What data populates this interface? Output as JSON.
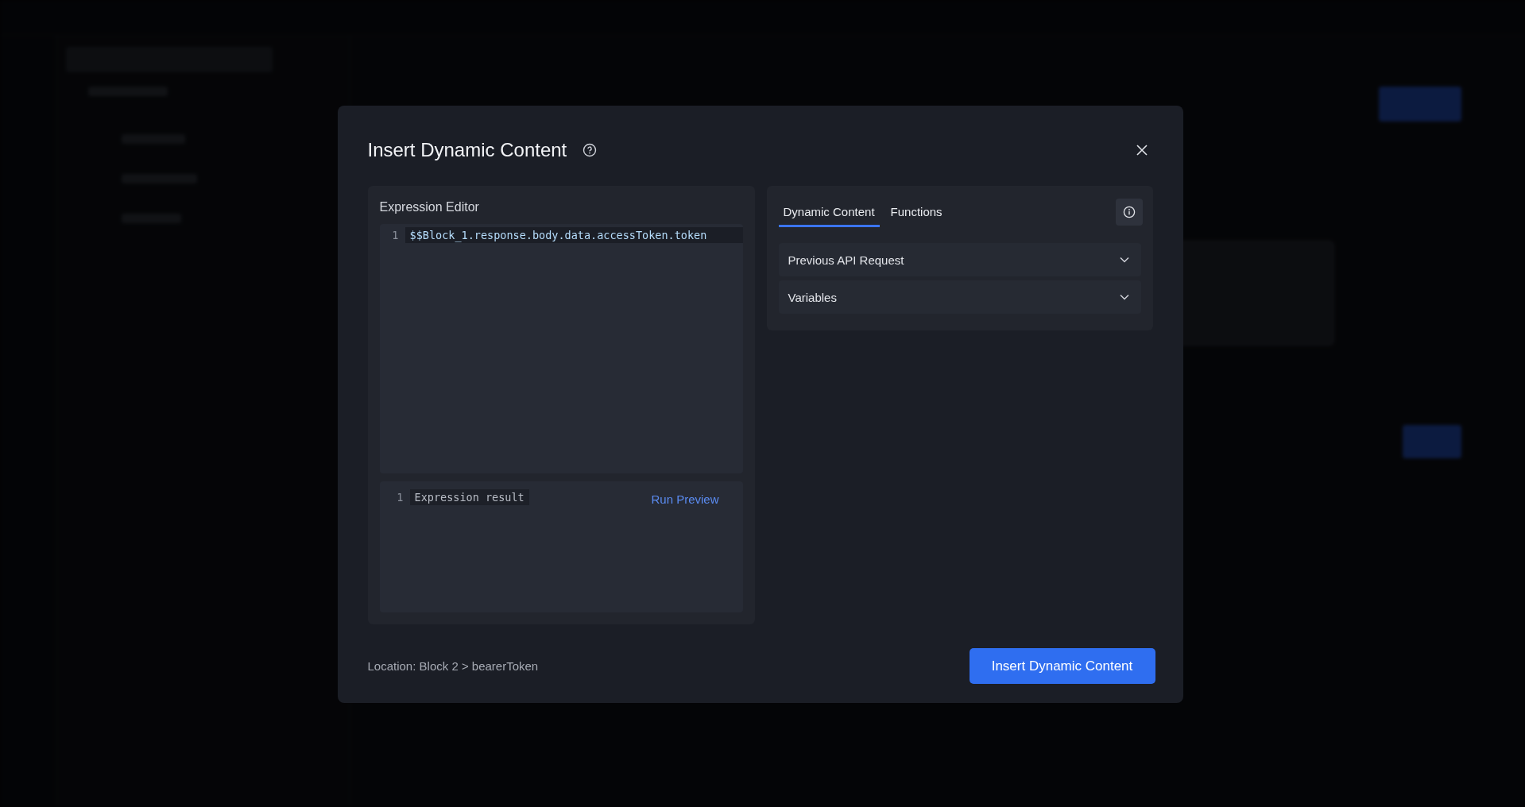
{
  "dialog": {
    "title": "Insert Dynamic Content",
    "editor": {
      "label": "Expression Editor",
      "lines": [
        {
          "number": "1",
          "code": "$$Block_1.response.body.data.accessToken.token"
        }
      ]
    },
    "result": {
      "lines": [
        {
          "number": "1",
          "text": "Expression result"
        }
      ],
      "run_link": "Run Preview"
    },
    "tabs": [
      {
        "label": "Dynamic Content",
        "selected": true
      },
      {
        "label": "Functions",
        "selected": false
      }
    ],
    "sections": [
      {
        "title": "Previous API Request",
        "expanded": false
      },
      {
        "title": "Variables",
        "expanded": false
      }
    ],
    "location": "Location: Block 2 > bearerToken",
    "primary_button": "Insert Dynamic Content"
  }
}
